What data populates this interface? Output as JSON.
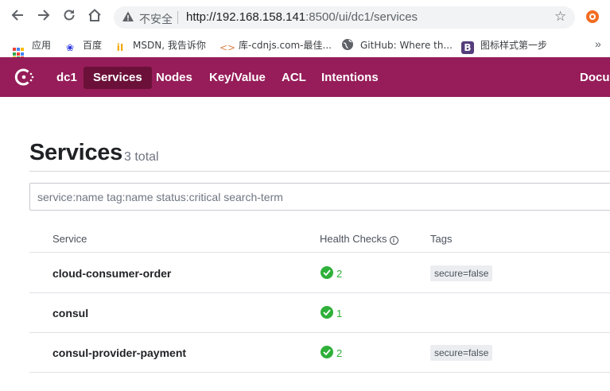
{
  "browser": {
    "insecure_label": "不安全",
    "url_host": "http://192.168.158.141",
    "url_rest": ":8500/ui/dc1/services"
  },
  "bookmarks": [
    {
      "label": "应用",
      "icon": "apps-grid-icon"
    },
    {
      "label": "百度",
      "icon": "baidu-paw-icon"
    },
    {
      "label": "MSDN, 我告诉你",
      "icon": "msdn-icon"
    },
    {
      "label": "库-cdnjs.com-最佳...",
      "icon": "code-brackets-icon"
    },
    {
      "label": "GitHub: Where th...",
      "icon": "globe-icon"
    },
    {
      "label": "图标样式第一步",
      "icon": "bootstrap-icon"
    }
  ],
  "colors": {
    "header_bg": "#961d59",
    "active_nav_bg": "#6b1139",
    "passing_green": "#2eb039"
  },
  "header": {
    "datacenter": "dc1",
    "nav": [
      {
        "label": "Services",
        "active": true
      },
      {
        "label": "Nodes",
        "active": false
      },
      {
        "label": "Key/Value",
        "active": false
      },
      {
        "label": "ACL",
        "active": false
      },
      {
        "label": "Intentions",
        "active": false
      }
    ],
    "docs_label": "Docu"
  },
  "page": {
    "title": "Services",
    "count": "3 total",
    "search_placeholder": "service:name tag:name status:critical search-term"
  },
  "table": {
    "columns": [
      "Service",
      "Health Checks",
      "Tags"
    ],
    "rows": [
      {
        "service": "cloud-consumer-order",
        "checks": "2",
        "tag": "secure=false"
      },
      {
        "service": "consul",
        "checks": "1",
        "tag": ""
      },
      {
        "service": "consul-provider-payment",
        "checks": "2",
        "tag": "secure=false"
      }
    ]
  }
}
